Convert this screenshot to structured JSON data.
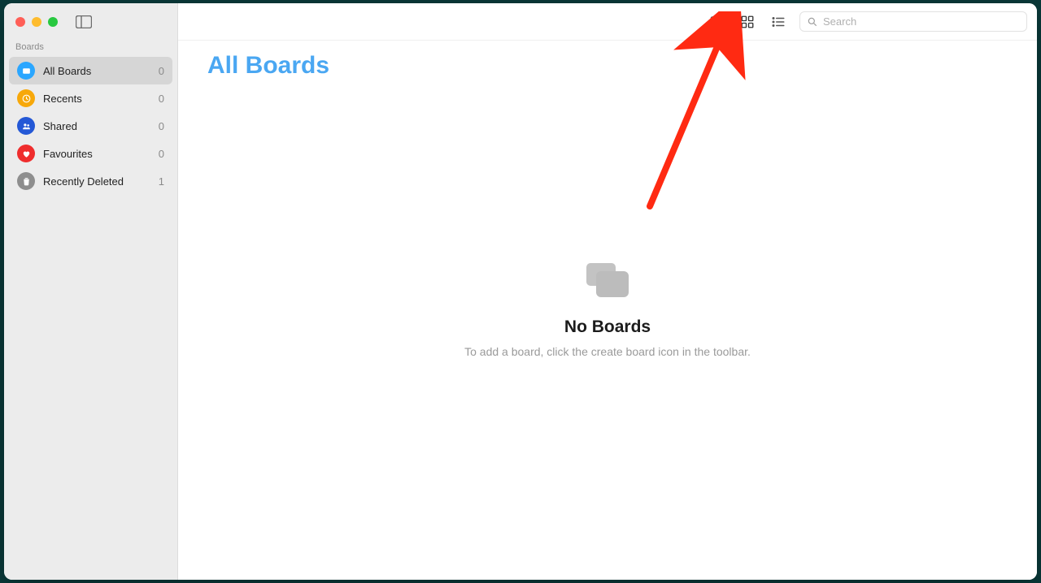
{
  "sidebar": {
    "section_label": "Boards",
    "items": [
      {
        "label": "All Boards",
        "count": "0",
        "icon": "board-icon",
        "color": "#2aa6ff",
        "selected": true
      },
      {
        "label": "Recents",
        "count": "0",
        "icon": "clock-icon",
        "color": "#f7a80a",
        "selected": false
      },
      {
        "label": "Shared",
        "count": "0",
        "icon": "people-icon",
        "color": "#2458d6",
        "selected": false
      },
      {
        "label": "Favourites",
        "count": "0",
        "icon": "heart-icon",
        "color": "#ef2d2d",
        "selected": false
      },
      {
        "label": "Recently Deleted",
        "count": "1",
        "icon": "trash-icon",
        "color": "#8e8e8e",
        "selected": false
      }
    ]
  },
  "toolbar": {
    "search_placeholder": "Search"
  },
  "page": {
    "title": "All Boards"
  },
  "empty_state": {
    "title": "No Boards",
    "subtitle": "To add a board, click the create board icon in the toolbar."
  }
}
